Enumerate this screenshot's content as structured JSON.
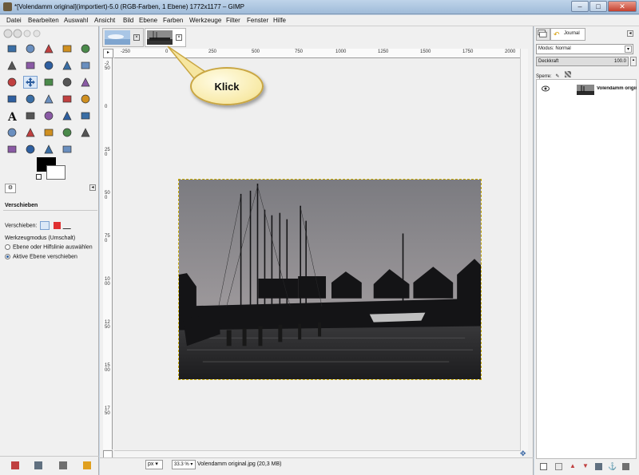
{
  "window": {
    "title": "*[Volendamm original](importiert)-5.0 (RGB-Farben, 1 Ebene) 1772x1177 – GIMP",
    "controls": [
      "–",
      "□",
      "✕"
    ]
  },
  "menu": [
    "Datei",
    "Bearbeiten",
    "Auswahl",
    "Ansicht",
    "Bild",
    "Ebene",
    "Farben",
    "Werkzeuge",
    "Filter",
    "Fenster",
    "Hilfe"
  ],
  "toolbox": {
    "tools": [
      "rect-select-icon",
      "ellipse-select-icon",
      "free-select-icon",
      "fuzzy-select-icon",
      "color-select-icon",
      "scissors-icon",
      "foreground-select-icon",
      "paths-icon",
      "color-picker-icon",
      "zoom-icon",
      "measure-icon",
      "move-icon",
      "align-icon",
      "crop-icon",
      "rotate-icon",
      "scale-icon",
      "shear-icon",
      "perspective-icon",
      "flip-icon",
      "cage-icon",
      "text-icon",
      "bucket-fill-icon",
      "blend-icon",
      "pencil-icon",
      "paintbrush-icon",
      "eraser-icon",
      "airbrush-icon",
      "ink-icon",
      "clone-icon",
      "heal-icon",
      "perspective-clone-icon",
      "blur-icon",
      "smudge-icon",
      "dodge-burn-icon"
    ],
    "active_tool_index": 11,
    "foreground_color": "#000000",
    "background_color": "#ffffff"
  },
  "tool_options": {
    "title": "Verschieben",
    "move_label": "Verschieben:",
    "mode_label": "Werkzeugmodus (Umschalt)",
    "options": [
      {
        "label": "Ebene oder Hilfslinie auswählen",
        "selected": false
      },
      {
        "label": "Aktive Ebene verschieben",
        "selected": true
      }
    ]
  },
  "image_tabs": [
    {
      "name": "sky-image-tab",
      "active": false
    },
    {
      "name": "volendamm-image-tab",
      "active": true
    }
  ],
  "ruler": {
    "top_ticks": [
      "-250",
      "0",
      "250",
      "500",
      "750",
      "1000",
      "1250",
      "1500",
      "1750",
      "2000"
    ],
    "left_ticks": [
      "-250",
      "0",
      "250",
      "500",
      "750",
      "1000",
      "1250",
      "1500",
      "1750"
    ]
  },
  "callout": {
    "text": "Klick"
  },
  "statusbar": {
    "unit": "px",
    "zoom": "33.3 %",
    "file_info": "Volendamm original.jpg (20,3 MB)"
  },
  "layers_panel": {
    "tab_journal": "Journal",
    "mode_label": "Modus: Normal",
    "opacity_label": "Deckkraft",
    "opacity_value": "100.0",
    "lock_label": "Sperre:",
    "layer_name": "Volendamm original"
  }
}
